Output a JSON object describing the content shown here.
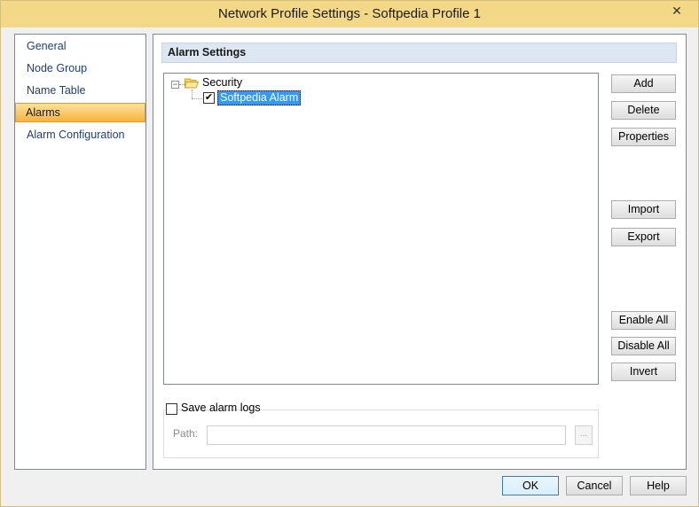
{
  "window": {
    "title": "Network Profile Settings - Softpedia Profile 1",
    "close_glyph": "✕"
  },
  "nav": {
    "items": [
      {
        "label": "General",
        "active": false
      },
      {
        "label": "Node Group",
        "active": false
      },
      {
        "label": "Name Table",
        "active": false
      },
      {
        "label": "Alarms",
        "active": true
      },
      {
        "label": "Alarm Configuration",
        "active": false
      }
    ]
  },
  "section": {
    "title": "Alarm Settings"
  },
  "tree": {
    "root": {
      "label": "Security",
      "icon": "folder-icon",
      "expander": "−"
    },
    "children": [
      {
        "label": "Softpedia Alarm",
        "checked": true,
        "check_glyph": "✔"
      }
    ]
  },
  "actions": {
    "add": "Add",
    "delete": "Delete",
    "properties": "Properties",
    "import": "Import",
    "export": "Export",
    "enable_all": "Enable All",
    "disable_all": "Disable All",
    "invert": "Invert"
  },
  "logs": {
    "save_label": "Save alarm logs",
    "save_checked": false,
    "path_label": "Path:",
    "path_value": "",
    "browse_label": "..."
  },
  "footer": {
    "ok": "OK",
    "cancel": "Cancel",
    "help": "Help"
  },
  "colors": {
    "titlebar": "#f2d887",
    "active_nav": "#f8b23e",
    "selection": "#3399ff",
    "nav_text": "#1e3f7a"
  }
}
